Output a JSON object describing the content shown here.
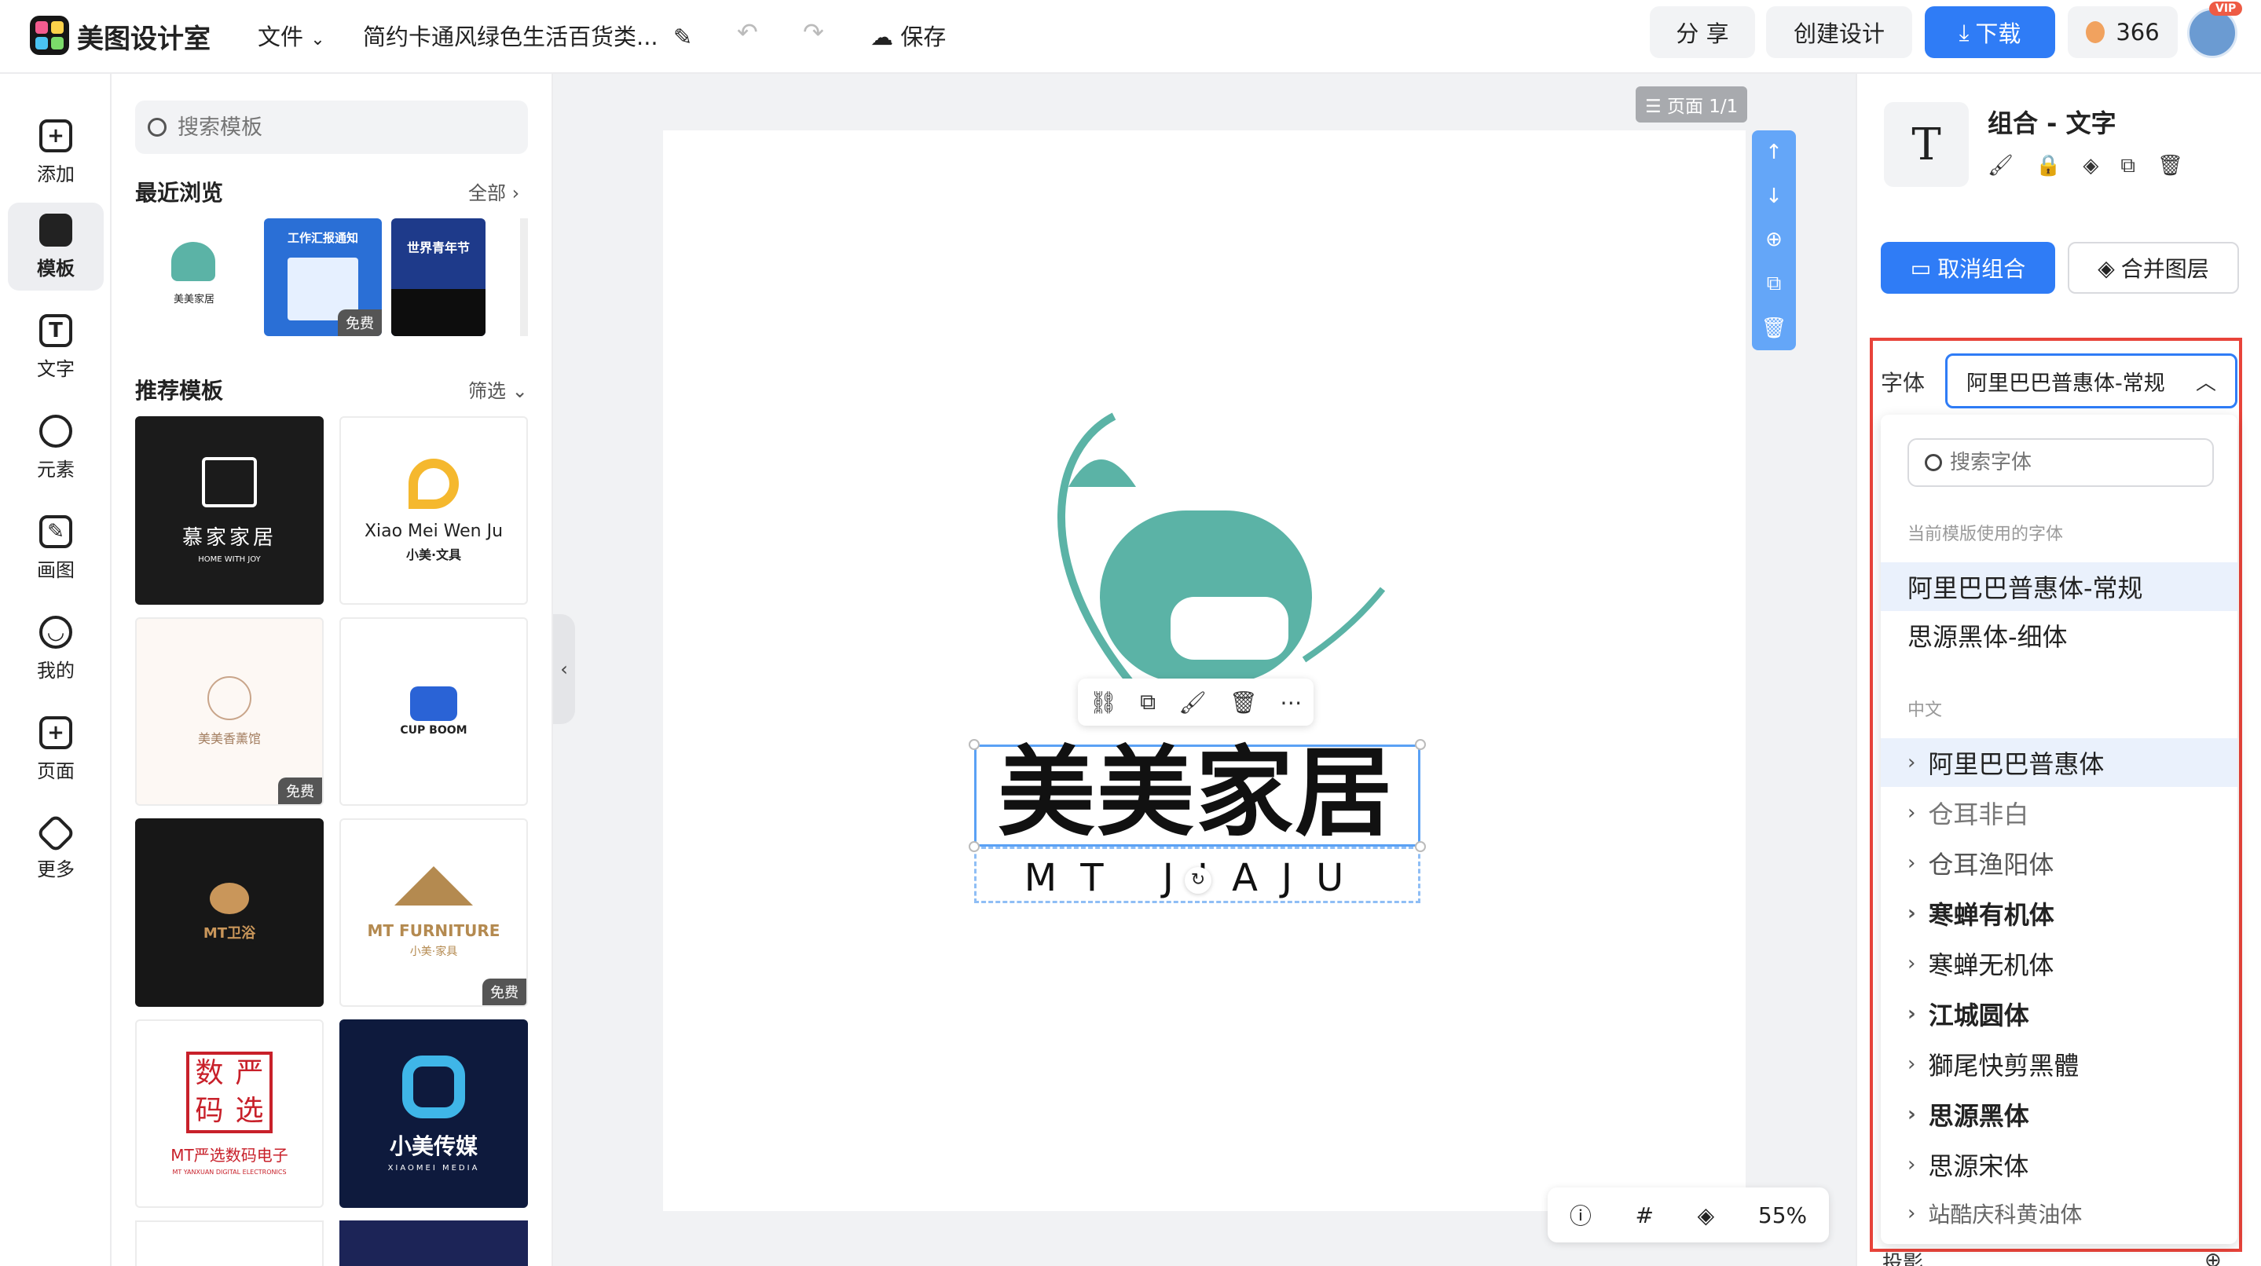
{
  "app": {
    "name": "美图设计室"
  },
  "topbar": {
    "file_menu": "文件",
    "doc_title": "简约卡通风绿色生活百货类...",
    "save": "保存",
    "share": "分 享",
    "create": "创建设计",
    "download": "下载",
    "credits": "366",
    "vip": "VIP"
  },
  "rail": {
    "items": [
      {
        "label": "添加"
      },
      {
        "label": "模板"
      },
      {
        "label": "文字"
      },
      {
        "label": "元素"
      },
      {
        "label": "画图"
      },
      {
        "label": "我的"
      },
      {
        "label": "页面"
      },
      {
        "label": "更多"
      }
    ]
  },
  "panel": {
    "search_placeholder": "搜索模板",
    "recent_title": "最近浏览",
    "recent_all": "全部",
    "recent": [
      {
        "name": "美美家居"
      },
      {
        "name": "工作汇报通知",
        "badge": "免费"
      },
      {
        "name": "世界青年节"
      }
    ],
    "recommend_title": "推荐模板",
    "filter": "筛选",
    "cards": [
      {
        "title": "慕家家居",
        "sub": "HOME WITH JOY"
      },
      {
        "title": "Xiao Mei Wen Ju",
        "sub": "小美·文具"
      },
      {
        "title": "美美香薰馆",
        "badge": "免费"
      },
      {
        "title": "CUP BOOM"
      },
      {
        "title": "MT卫浴"
      },
      {
        "title": "MT FURNITURE",
        "sub": "小美·家具",
        "badge": "免费"
      },
      {
        "title": "MT严选数码电子",
        "sub": "MT YANXUAN DIGITAL ELECTRONICS",
        "seal": [
          "数",
          "严",
          "码",
          "选"
        ]
      },
      {
        "title": "小美传媒",
        "sub": "XIAOMEI MEDIA"
      }
    ]
  },
  "canvas": {
    "page_badge": "页面 1/1",
    "brand_main": "美美家居",
    "brand_sub": "MT JIAJU",
    "zoom": "55%"
  },
  "right": {
    "title": "组合 - 文字",
    "ungroup": "取消组合",
    "merge": "合并图层",
    "font_label": "字体",
    "font_value": "阿里巴巴普惠体-常规",
    "font_search_placeholder": "搜索字体",
    "used_header": "当前模版使用的字体",
    "used_fonts": [
      "阿里巴巴普惠体-常规",
      "思源黑体-细体"
    ],
    "cn_header": "中文",
    "cn_fonts": [
      "阿里巴巴普惠体",
      "仓耳非白",
      "仓耳渔阳体",
      "寒蝉有机体",
      "寒蝉无机体",
      "江城圆体",
      "獅尾快剪黑體",
      "思源黑体",
      "思源宋体",
      "站酷庆科黄油体"
    ],
    "shadow_label": "投影"
  },
  "colors": {
    "accent": "#2f7cf6",
    "teal": "#5bb3a6",
    "highlight": "#e8433a"
  }
}
